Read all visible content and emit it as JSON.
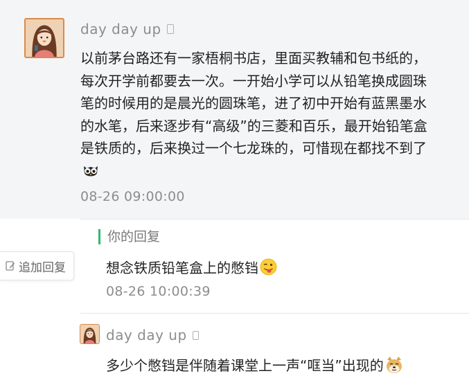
{
  "comment": {
    "nickname": "day day up",
    "lines": [
      "以前茅台路还有一家梧桐书店，里面买教辅和包书纸的，",
      "每次开学前都要去一次。一开始小学可以从铅笔换成圆珠",
      "笔的时候用的是晨光的圆珠笔，进了初中开始有蓝黑墨水",
      "的水笔，后来逐步有“高级”的三菱和百乐，最开始铅笔盒",
      "是铁质的，后来换过一个七龙珠的，可惜现在都找不到了"
    ],
    "emoji": "owl-emoji",
    "timestamp": "08-26 09:00:00"
  },
  "author_reply": {
    "label": "你的回复",
    "text": "想念铁质铅笔盒上的憋铛",
    "emoji": "wink-tongue-emoji",
    "timestamp": "08-26 10:00:39"
  },
  "add_reply": {
    "label": "追加回复",
    "icon": "edit-icon"
  },
  "sub_reply": {
    "nickname": "day day up",
    "text": "多少个憋铛是伴随着课堂上一声“哐当”出现的",
    "emoji": "doge-emoji"
  },
  "colors": {
    "card_background": "#f4f5f7",
    "accent_green": "#2fb86b",
    "muted_text": "#8d8d8d",
    "body_text": "#222222"
  }
}
